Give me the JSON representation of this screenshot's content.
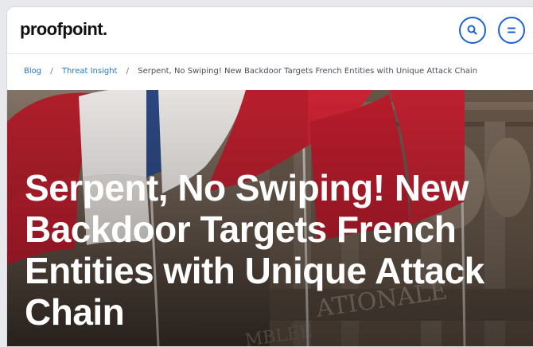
{
  "header": {
    "logo_text": "proofpoint.",
    "search_icon": "search-icon",
    "menu_icon": "menu-icon",
    "accent_color": "#1f5fd6"
  },
  "breadcrumb": {
    "items": [
      "Blog",
      "Threat Insight"
    ],
    "separator": "/",
    "current": "Serpent, No Swiping! New Backdoor Targets French Entities with Unique Attack Chain",
    "link_color": "#1f78c8"
  },
  "hero": {
    "title": "Serpent, No Swiping! New Backdoor Targets French Entities with Unique Attack Chain",
    "background": "French flags waving in front of a classical building facade"
  }
}
